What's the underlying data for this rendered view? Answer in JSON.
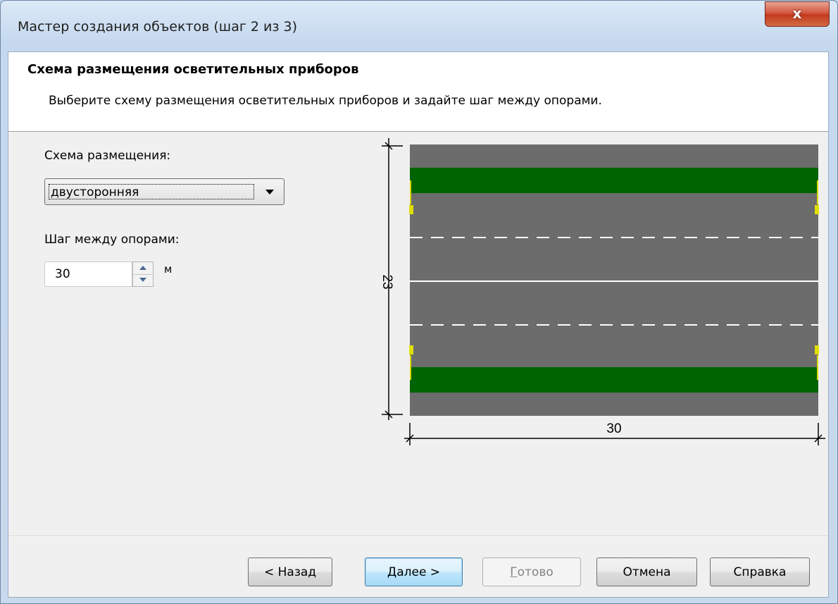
{
  "window": {
    "title": "Мастер создания объектов (шаг 2 из 3)",
    "close_label": "x"
  },
  "header": {
    "title": "Схема размещения осветительных приборов",
    "description": "Выберите схему размещения осветительных приборов и задайте шаг между опорами."
  },
  "form": {
    "scheme_label": "Схема размещения:",
    "scheme_value": "двусторонняя",
    "step_label": "Шаг между опорами:",
    "step_value": "30",
    "step_unit": "м"
  },
  "diagram": {
    "width_label": "30",
    "height_label": "23",
    "colors": {
      "road": "#6c6c6c",
      "median_strip": "#006400",
      "lamp": "#e0e000",
      "marking": "#ffffff"
    }
  },
  "buttons": {
    "back": "< Назад",
    "next": "Далее >",
    "finish_first": "Г",
    "finish_rest": "отово",
    "cancel": "Отмена",
    "help": "Справка"
  }
}
